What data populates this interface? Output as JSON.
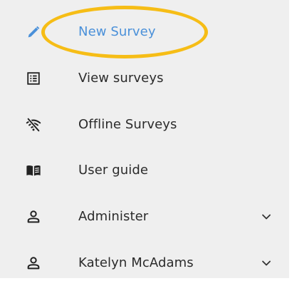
{
  "menu": {
    "items": [
      {
        "label": "New Survey",
        "icon": "pencil-icon",
        "active": true,
        "expandable": false
      },
      {
        "label": "View surveys",
        "icon": "list-icon",
        "active": false,
        "expandable": false
      },
      {
        "label": "Offline Surveys",
        "icon": "wifi-off-icon",
        "active": false,
        "expandable": false
      },
      {
        "label": "User guide",
        "icon": "book-icon",
        "active": false,
        "expandable": false
      },
      {
        "label": "Administer",
        "icon": "person-icon",
        "active": false,
        "expandable": true
      },
      {
        "label": "Katelyn McAdams",
        "icon": "person-icon",
        "active": false,
        "expandable": true
      }
    ]
  },
  "colors": {
    "panel_background": "#efefef",
    "active_text": "#4a90d9",
    "text": "#2b2b2b",
    "icon": "#222222",
    "pencil_icon": "#4a90d9",
    "highlight_annotation": "#f6bd16"
  }
}
